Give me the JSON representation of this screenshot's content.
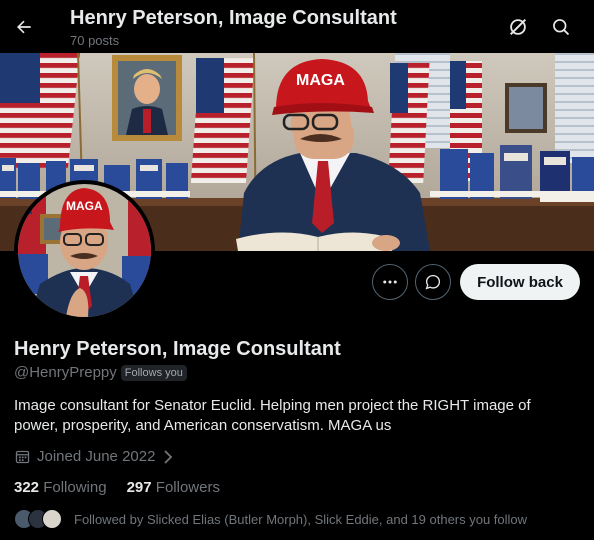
{
  "header": {
    "title": "Henry Peterson, Image Consultant",
    "post_count": "70 posts",
    "back_icon": "arrow-left-icon",
    "grok_icon": "grok-icon",
    "search_icon": "search-icon"
  },
  "banner": {
    "cap_text": "MAGA"
  },
  "avatar": {
    "cap_text": "MAGA"
  },
  "actions": {
    "more_icon": "more-icon",
    "message_icon": "message-icon",
    "follow_back": "Follow back"
  },
  "profile": {
    "name": "Henry Peterson, Image Consultant",
    "handle": "@HenryPreppy",
    "follows_you": "Follows you",
    "bio": "Image consultant for Senator Euclid. Helping men project the RIGHT image of power, prosperity, and American conservatism. MAGA us",
    "joined": "Joined June 2022",
    "following_count": "322",
    "following_label": "Following",
    "followers_count": "297",
    "followers_label": "Followers",
    "followed_by": "Followed by Slicked Elias (Butler Morph), Slick Eddie, and 19 others you follow"
  },
  "colors": {
    "background": "#000000",
    "text_primary": "#e7e9ea",
    "text_secondary": "#71767b",
    "button_light": "#eff3f4",
    "cap_red": "#c8161d"
  }
}
